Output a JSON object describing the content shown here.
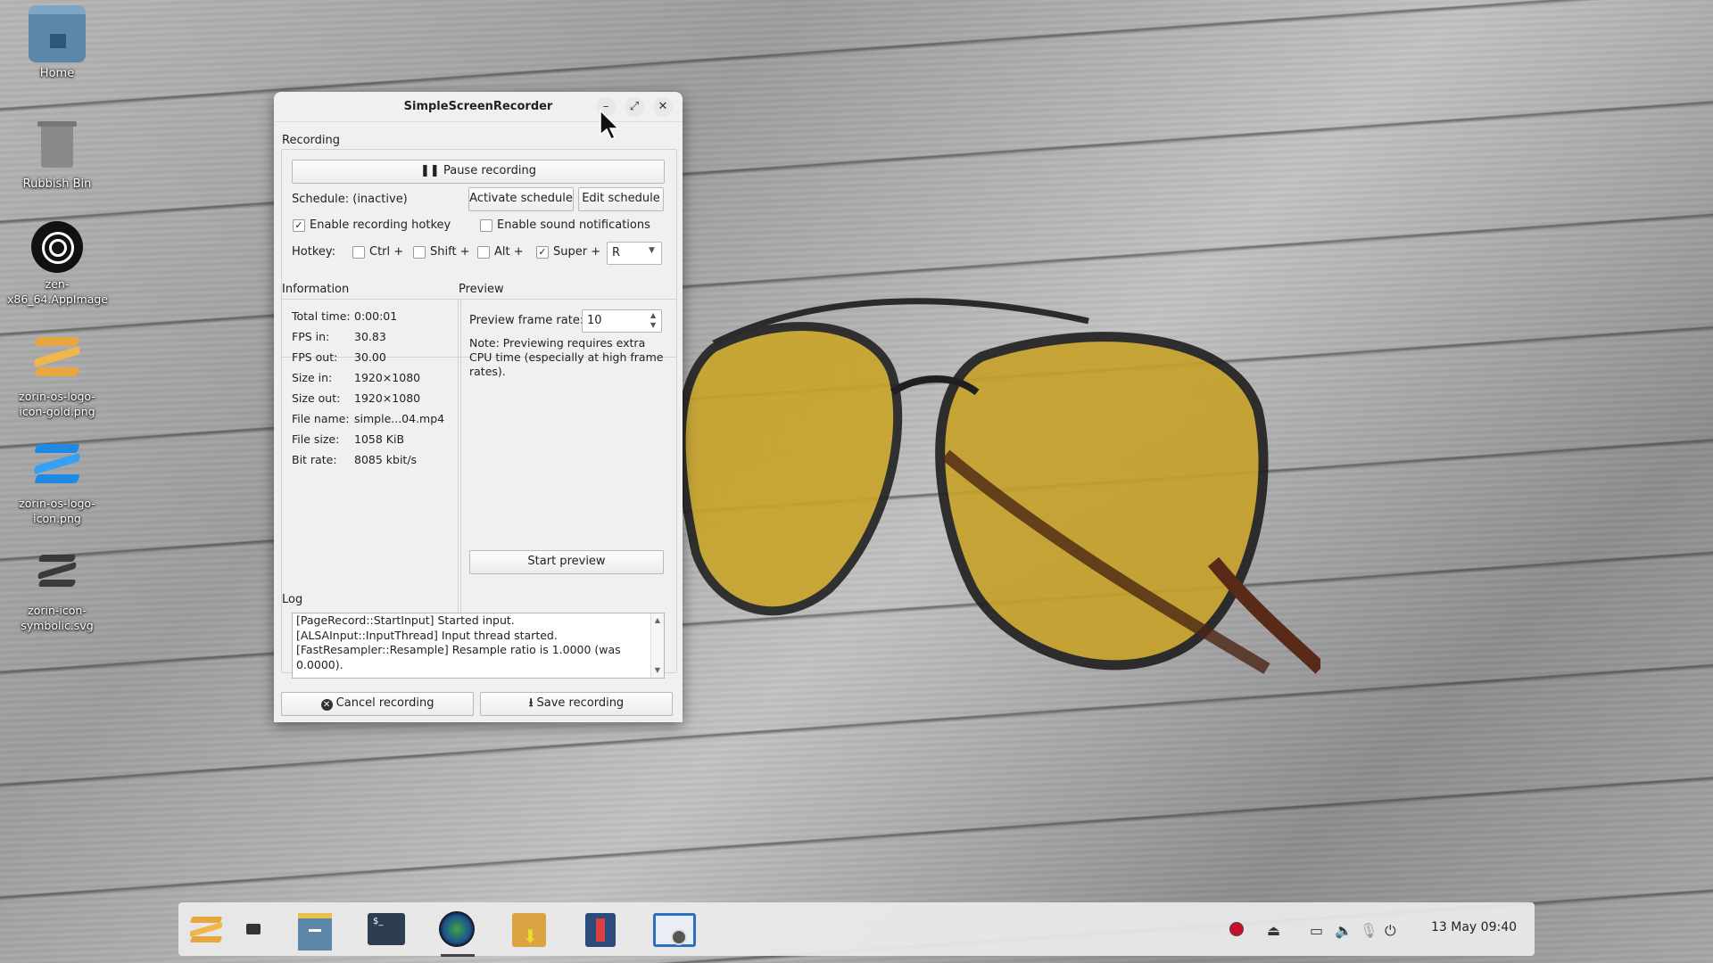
{
  "desktop": {
    "icons": [
      {
        "label": "Home",
        "icon": "home-folder-icon"
      },
      {
        "label": "Rubbish Bin",
        "icon": "trash-icon"
      },
      {
        "label": "zen-x86_64.AppImage",
        "icon": "zen-browser-icon"
      },
      {
        "label": "zorin-os-logo-icon-gold.png",
        "icon": "zorin-logo-gold-icon"
      },
      {
        "label": "zorin-os-logo-icon.png",
        "icon": "zorin-logo-blue-icon"
      },
      {
        "label": "zorin-icon-symbolic.svg",
        "icon": "zorin-logo-symbolic-icon"
      }
    ]
  },
  "window": {
    "title": "SimpleScreenRecorder",
    "controls": {
      "minimize": "–",
      "maximize": "⤢",
      "close": "✕"
    }
  },
  "recording": {
    "section_label": "Recording",
    "pause_button": "Pause recording",
    "schedule_label": "Schedule: (inactive)",
    "activate_schedule": "Activate schedule",
    "edit_schedule": "Edit schedule",
    "enable_hotkey": {
      "label": "Enable recording hotkey",
      "checked": true
    },
    "enable_sound": {
      "label": "Enable sound notifications",
      "checked": false
    },
    "hotkey_label": "Hotkey:",
    "modifiers": [
      {
        "label": "Ctrl +",
        "checked": false
      },
      {
        "label": "Shift +",
        "checked": false
      },
      {
        "label": "Alt +",
        "checked": false
      },
      {
        "label": "Super +",
        "checked": true
      }
    ],
    "key": "R"
  },
  "information": {
    "section_label": "Information",
    "rows": [
      {
        "key": "Total time:",
        "value": "0:00:01"
      },
      {
        "key": "FPS in:",
        "value": "30.83"
      },
      {
        "key": "FPS out:",
        "value": "30.00"
      },
      {
        "key": "Size in:",
        "value": "1920×1080"
      },
      {
        "key": "Size out:",
        "value": "1920×1080"
      },
      {
        "key": "File name:",
        "value": "simple...04.mp4"
      },
      {
        "key": "File size:",
        "value": "1058 KiB"
      },
      {
        "key": "Bit rate:",
        "value": "8085 kbit/s"
      }
    ]
  },
  "preview": {
    "section_label": "Preview",
    "frame_rate_label": "Preview frame rate:",
    "frame_rate_value": "10",
    "note": "Note: Previewing requires extra CPU time (especially at high frame rates).",
    "start_button": "Start preview"
  },
  "log": {
    "section_label": "Log",
    "lines": [
      "[PageRecord::StartInput] Started input.",
      "[ALSAInput::InputThread] Input thread started.",
      "[FastResampler::Resample] Resample ratio is 1.0000 (was 0.0000)."
    ]
  },
  "footer": {
    "cancel": "Cancel recording",
    "save": "Save recording"
  },
  "taskbar": {
    "apps": [
      "zorin-menu-icon",
      "show-desktop-icon",
      "files-icon",
      "terminal-icon",
      "zen-browser-icon",
      "software-store-icon",
      "code-editor-icon",
      "screen-recorder-icon"
    ],
    "tray": [
      "recording-indicator-icon",
      "eject-icon",
      "display-icon",
      "volume-icon",
      "microphone-muted-icon",
      "power-icon"
    ],
    "clock": "13 May  09:40"
  },
  "colors": {
    "recording_dot": "#c8102e",
    "window_bg": "#f0f0f0",
    "zorin_gold": "#e8a640",
    "zorin_blue": "#1e8ae6"
  }
}
